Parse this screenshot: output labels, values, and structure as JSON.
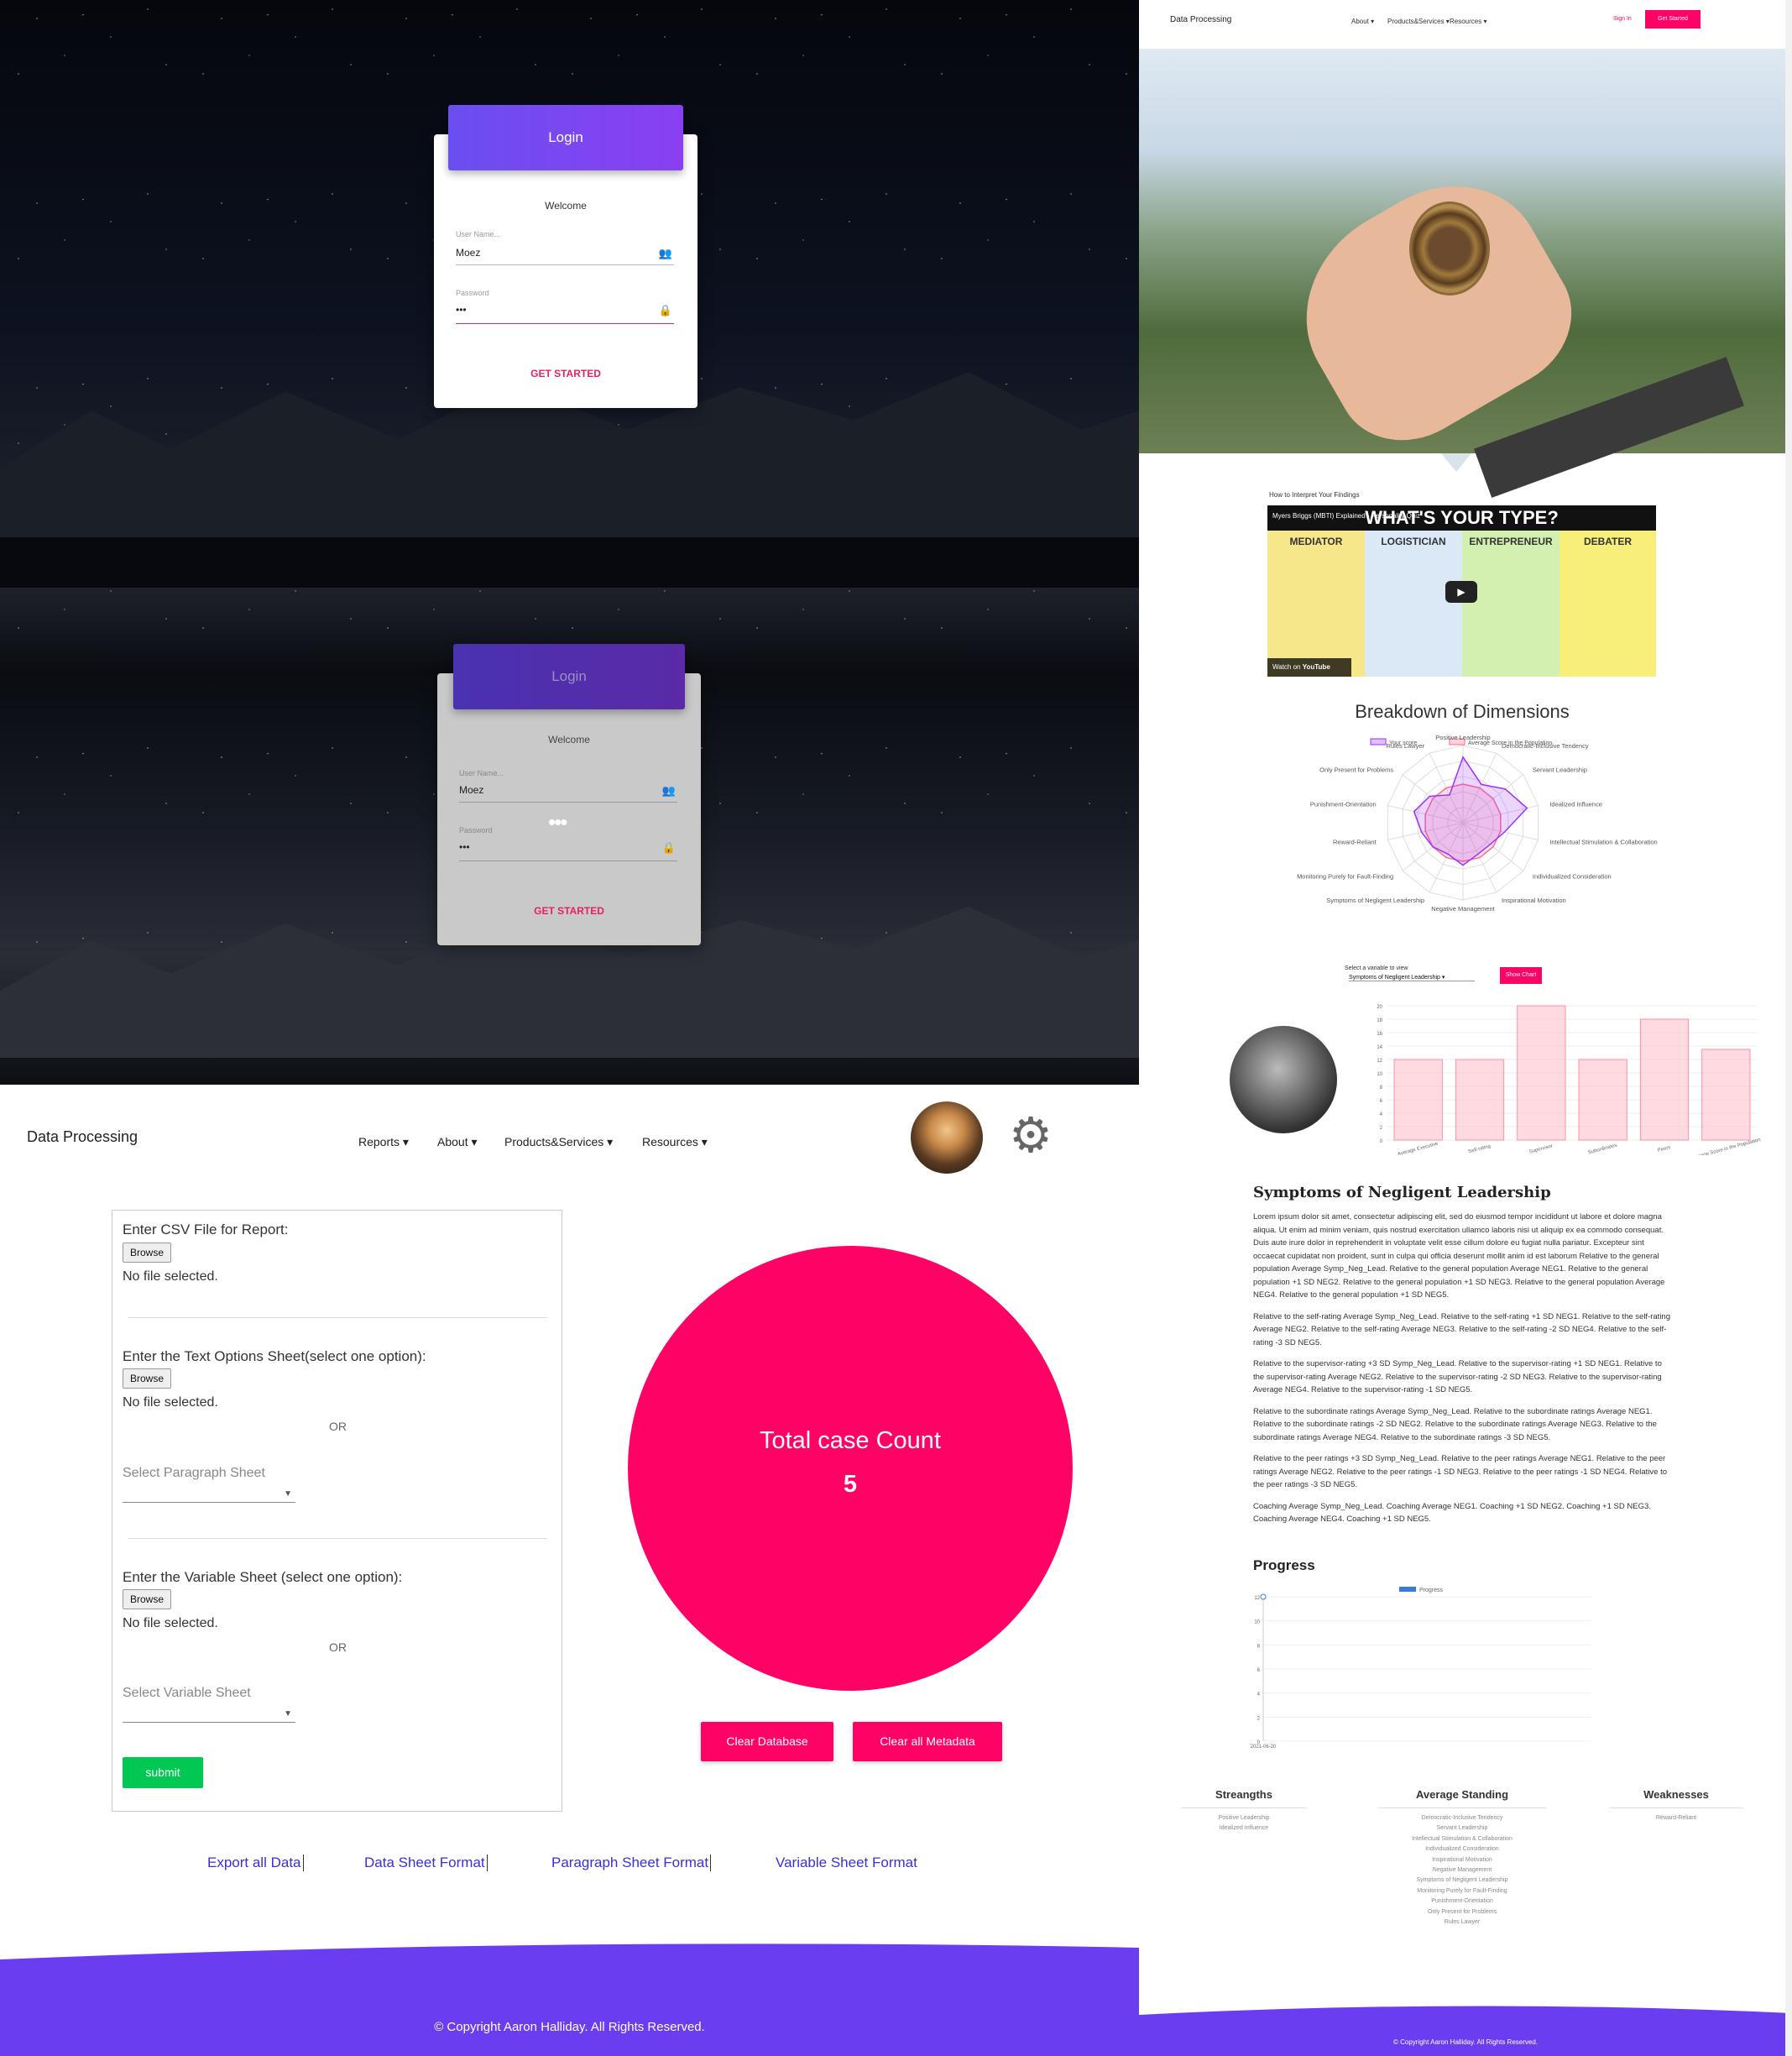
{
  "login": {
    "title": "Login",
    "welcome": "Welcome",
    "username_label": "User Name...",
    "username_value": "Moez",
    "password_label": "Password",
    "password_value": "•••",
    "submit_label": "GET STARTED"
  },
  "site": {
    "brand": "Data Processing",
    "nav": [
      "Reports ▾",
      "About ▾",
      "Products&Services ▾",
      "Resources ▾"
    ],
    "signin": "Sign In",
    "get_started": "Get Started"
  },
  "video": {
    "header": "How to Interpret Your Findings",
    "overlay_title": "Myers Briggs (MBTI) Explained - Personality Quiz",
    "banner": "WHAT'S YOUR TYPE?",
    "panels": [
      "MEDIATOR",
      "LOGISTICIAN",
      "ENTREPRENEUR",
      "DEBATER"
    ],
    "watch_on": "Watch on",
    "youtube": "YouTube"
  },
  "dimensions": {
    "title": "Breakdown of Dimensions",
    "legend": [
      "Your score",
      "Average Score in the Population"
    ],
    "axes": [
      "Positive Leadership",
      "Democratic-Inclusive Tendency",
      "Servant Leadership",
      "Idealized Influence",
      "Intellectual Stimulation & Collaboration",
      "Individualized Consideration",
      "Inspirational Motivation",
      "Negative Management",
      "Symptoms of Negligent Leadership",
      "Monitoring Purely for Fault-Finding",
      "Reward-Reliant",
      "Punishment-Orientation",
      "Only Present for Problems",
      "Rules Lawyer"
    ]
  },
  "chart_data": [
    {
      "type": "radar",
      "title": "Breakdown of Dimensions",
      "categories": [
        "Positive Leadership",
        "Democratic-Inclusive Tendency",
        "Servant Leadership",
        "Idealized Influence",
        "Intellectual Stimulation & Collaboration",
        "Individualized Consideration",
        "Inspirational Motivation",
        "Negative Management",
        "Symptoms of Negligent Leadership",
        "Monitoring Purely for Fault-Finding",
        "Reward-Reliant",
        "Punishment-Orientation",
        "Only Present for Problems",
        "Rules Lawyer"
      ],
      "series": [
        {
          "name": "Your score",
          "values": [
            0.85,
            0.55,
            0.7,
            0.85,
            0.55,
            0.45,
            0.45,
            0.55,
            0.45,
            0.5,
            0.55,
            0.65,
            0.55,
            0.4
          ],
          "color": "#9b30ff"
        },
        {
          "name": "Average Score in the Population",
          "values": [
            0.5,
            0.5,
            0.5,
            0.5,
            0.5,
            0.5,
            0.5,
            0.5,
            0.5,
            0.5,
            0.5,
            0.5,
            0.5,
            0.5
          ],
          "color": "#ff6b8a"
        }
      ]
    },
    {
      "type": "bar",
      "categories": [
        "Average Executive",
        "Self-rating",
        "Supervisor",
        "Subordinates",
        "Peers",
        "Average Score in the Population"
      ],
      "values": [
        12,
        12,
        20,
        12,
        18,
        13.5
      ],
      "ylim": [
        0,
        20
      ]
    },
    {
      "type": "line",
      "legend": [
        "Progress"
      ],
      "x": [
        "2021-06-20"
      ],
      "values": [
        12
      ],
      "ylim": [
        0,
        12
      ]
    }
  ],
  "variable_select": {
    "label": "Select a variable to view",
    "value": "Symptoms of Negligent Leadership",
    "button": "Show Chart",
    "bar_yticks": [
      "20",
      "18",
      "16",
      "14",
      "12",
      "10",
      "8",
      "6",
      "4",
      "2",
      "0"
    ]
  },
  "section": {
    "title": "Symptoms of Negligent Leadership",
    "paragraphs": [
      "Lorem ipsum dolor sit amet, consectetur adipiscing elit, sed do eiusmod tempor incididunt ut labore et dolore magna aliqua. Ut enim ad minim veniam, quis nostrud exercitation ullamco laboris nisi ut aliquip ex ea commodo consequat. Duis aute irure dolor in reprehenderit in voluptate velit esse cillum dolore eu fugiat nulla pariatur. Excepteur sint occaecat cupidatat non proident, sunt in culpa qui officia deserunt mollit anim id est laborum Relative to the general population Average Symp_Neg_Lead. Relative to the general population Average NEG1. Relative to the general population +1 SD NEG2. Relative to the general population +1 SD NEG3. Relative to the general population Average NEG4. Relative to the general population +1 SD NEG5.",
      "Relative to the self-rating Average Symp_Neg_Lead. Relative to the self-rating +1 SD NEG1. Relative to the self-rating Average NEG2. Relative to the self-rating Average NEG3. Relative to the self-rating -2 SD NEG4. Relative to the self-rating -3 SD NEG5.",
      "Relative to the supervisor-rating +3 SD Symp_Neg_Lead. Relative to the supervisor-rating +1 SD NEG1. Relative to the supervisor-rating Average NEG2. Relative to the supervisor-rating -2 SD NEG3. Relative to the supervisor-rating Average NEG4. Relative to the supervisor-rating -1 SD NEG5.",
      "Relative to the subordinate ratings Average Symp_Neg_Lead. Relative to the subordinate ratings Average NEG1. Relative to the subordinate ratings -2 SD NEG2. Relative to the subordinate ratings Average NEG3. Relative to the subordinate ratings Average NEG4. Relative to the subordinate ratings -3 SD NEG5.",
      "Relative to the peer ratings +3 SD Symp_Neg_Lead. Relative to the peer ratings Average NEG1. Relative to the peer ratings Average NEG2. Relative to the peer ratings -1 SD NEG3. Relative to the peer ratings -1 SD NEG4. Relative to the peer ratings -3 SD NEG5.",
      "Coaching Average Symp_Neg_Lead. Coaching Average NEG1. Coaching +1 SD NEG2. Coaching +1 SD NEG3. Coaching Average NEG4. Coaching +1 SD NEG5."
    ]
  },
  "progress": {
    "title": "Progress",
    "legend": "Progress",
    "yticks": [
      "12",
      "10",
      "8",
      "6",
      "4",
      "2",
      "0"
    ],
    "xtick": "2021-06-20"
  },
  "summary": {
    "strengths_title": "Streangths",
    "strengths": [
      "Positive Leadership",
      "Idealized Influence"
    ],
    "average_title": "Average Standing",
    "average": [
      "Democratic-Inclusive Tendency",
      "Servant Leadership",
      "Intellectual Stimulation & Collaboration",
      "Individualized Consideration",
      "Inspirational Motivation",
      "Negative Management",
      "Symptoms of Negligent Leadership",
      "Monitoring Purely for Fault-Finding",
      "Punishment-Orientation",
      "Only Present for Problems",
      "Rules Lawyer"
    ],
    "weaknesses_title": "Weaknesses",
    "weaknesses": [
      "Reward-Reliant"
    ]
  },
  "footer": {
    "copyright": "© Copyright Aaron Halliday. All Rights Reserved."
  },
  "upload": {
    "csv_label": "Enter CSV File for Report:",
    "browse": "Browse",
    "no_file": "No file selected.",
    "text_options_label": "Enter the Text Options Sheet(select one option):",
    "or": "OR",
    "select_paragraph": "Select Paragraph Sheet",
    "variable_label": "Enter the Variable Sheet (select one option):",
    "select_variable": "Select Variable Sheet",
    "submit": "submit"
  },
  "counter": {
    "label": "Total case Count",
    "value": "5"
  },
  "admin": {
    "clear_db": "Clear Database",
    "clear_meta": "Clear all Metadata"
  },
  "links": [
    "Export all Data",
    "Data Sheet Format",
    "Paragraph Sheet Format",
    "Variable Sheet Format"
  ],
  "colors": {
    "accent": "#ff0266",
    "purple": "#6a4ff0",
    "submit": "#00c853"
  }
}
